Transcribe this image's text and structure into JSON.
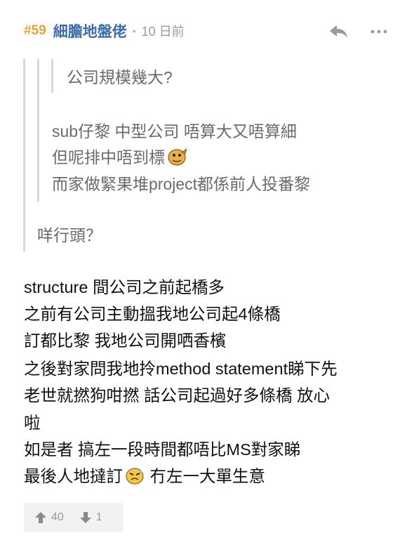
{
  "post": {
    "number": "#59",
    "username": "細膽地盤佬",
    "separator": "•",
    "time": "10 日前"
  },
  "quote": {
    "level3": "公司規模幾大?",
    "level2": [
      "sub仔黎 中型公司 唔算大又唔算細",
      "但呢排中唔到標",
      "而家做緊果堆project都係前人投番黎"
    ],
    "level1": "咩行頭？"
  },
  "body": [
    "structure 間公司之前起橋多",
    "之前有公司主動搵我地公司起4條橋",
    "訂都比黎 我地公司開哂香檳",
    "之後對家問我地拎method statement睇下先",
    "老世就撚狗咁撚 話公司起過好多條橋 放心",
    "啦",
    "如是者 搞左一段時間都唔比MS對家睇",
    "最後人地撻訂",
    " 冇左一大單生意"
  ],
  "votes": {
    "up": "40",
    "down": "1"
  },
  "icons": {
    "reply": "reply-icon",
    "more": "more-icon",
    "up": "thumb-up-arrow-icon",
    "down": "thumb-down-arrow-icon",
    "emoji1": "pointing-emoji-icon",
    "emoji2": "sweating-emoji-icon"
  },
  "colors": {
    "number": "#e6a23c",
    "username": "#3d6ea8",
    "quote_text": "#6a6a6a",
    "quote_bar": "#d8d8d8",
    "vote_bg": "#f2f2f2"
  }
}
